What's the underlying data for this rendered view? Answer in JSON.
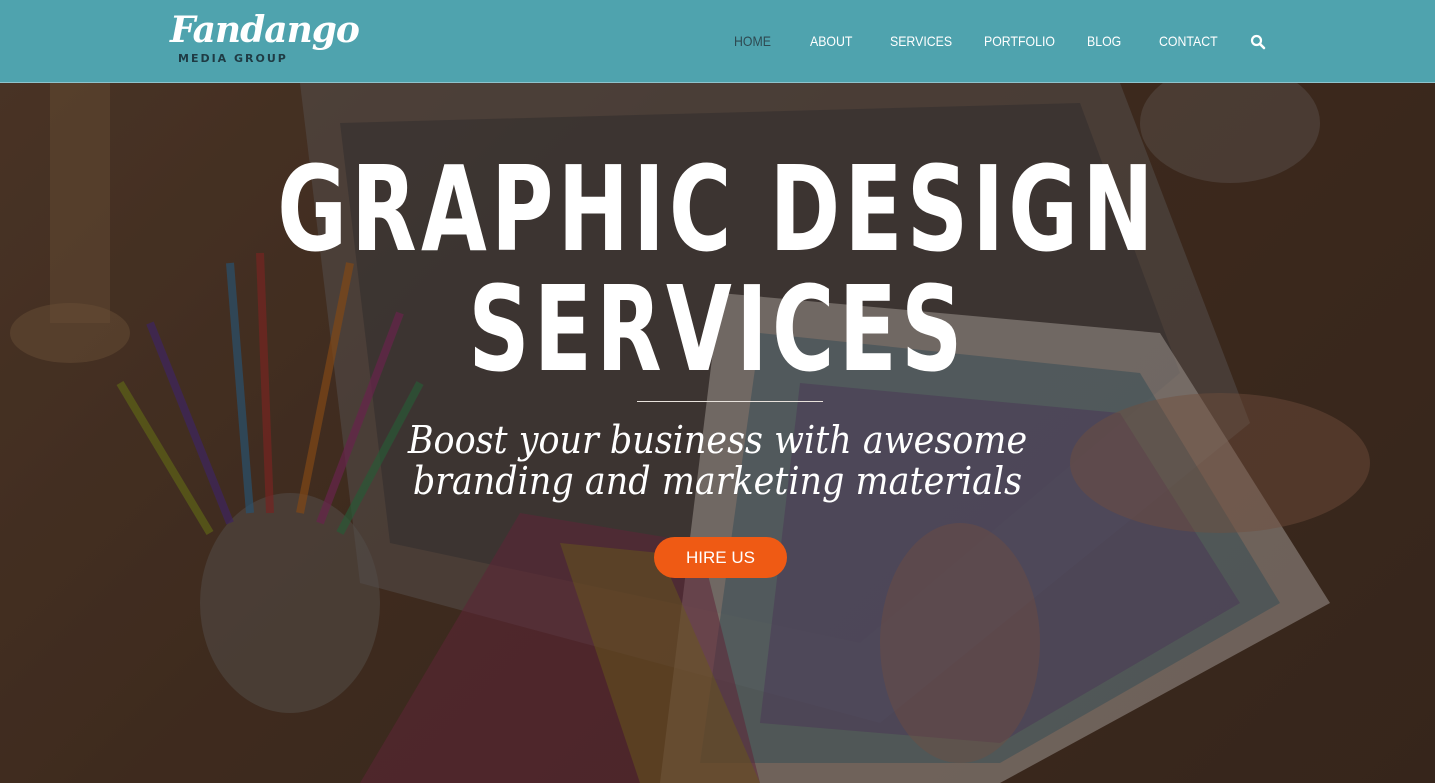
{
  "brand": {
    "logo_script": "Fandango",
    "logo_sub": "MEDIA GROUP"
  },
  "colors": {
    "header_bg": "#4fa3ae",
    "accent": "#ef5a14",
    "nav_active": "#2e4a52"
  },
  "nav": {
    "items": [
      {
        "label": "HOME",
        "active": true
      },
      {
        "label": "ABOUT",
        "active": false
      },
      {
        "label": "SERVICES",
        "active": false
      },
      {
        "label": "PORTFOLIO",
        "active": false
      },
      {
        "label": "BLOG",
        "active": false
      },
      {
        "label": "CONTACT",
        "active": false
      }
    ],
    "search_icon": "search-icon"
  },
  "hero": {
    "title_line1": "GRAPHIC DESIGN",
    "title_line2": "SERVICES",
    "tagline_line1": "Boost your business with awesome",
    "tagline_line2": "branding and marketing materials",
    "cta_label": "HIRE US"
  }
}
